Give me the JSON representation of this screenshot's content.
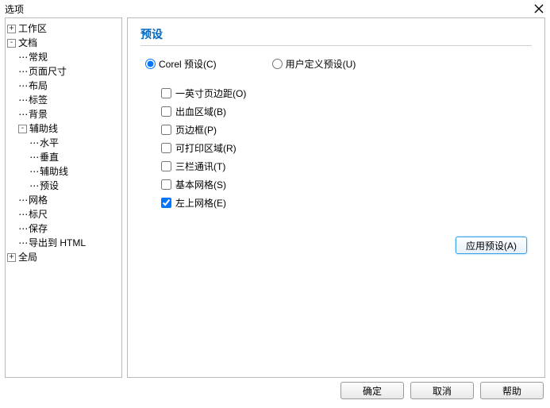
{
  "window": {
    "title": "选项"
  },
  "tree": {
    "workspace": "工作区",
    "document": "文档",
    "general": "常规",
    "pageSize": "页面尺寸",
    "layout": "布局",
    "labels": "标签",
    "background": "背景",
    "guidelines": "辅助线",
    "horizontal": "水平",
    "vertical": "垂直",
    "guides": "辅助线",
    "presets": "预设",
    "grid": "网格",
    "ruler": "标尺",
    "save": "保存",
    "exportHtml": "导出到 HTML",
    "global": "全局"
  },
  "panel": {
    "title": "预设",
    "radios": {
      "corel": "Corel 预设(C)",
      "user": "用户定义预设(U)"
    },
    "checks": {
      "oneInch": "一英寸页边距(O)",
      "bleed": "出血区域(B)",
      "pageBorder": "页边框(P)",
      "printable": "可打印区域(R)",
      "threeCol": "三栏通讯(T)",
      "basicGrid": "基本网格(S)",
      "upperLeftGrid": "左上网格(E)"
    },
    "applyBtn": "应用预设(A)"
  },
  "footer": {
    "ok": "确定",
    "cancel": "取消",
    "help": "帮助"
  }
}
